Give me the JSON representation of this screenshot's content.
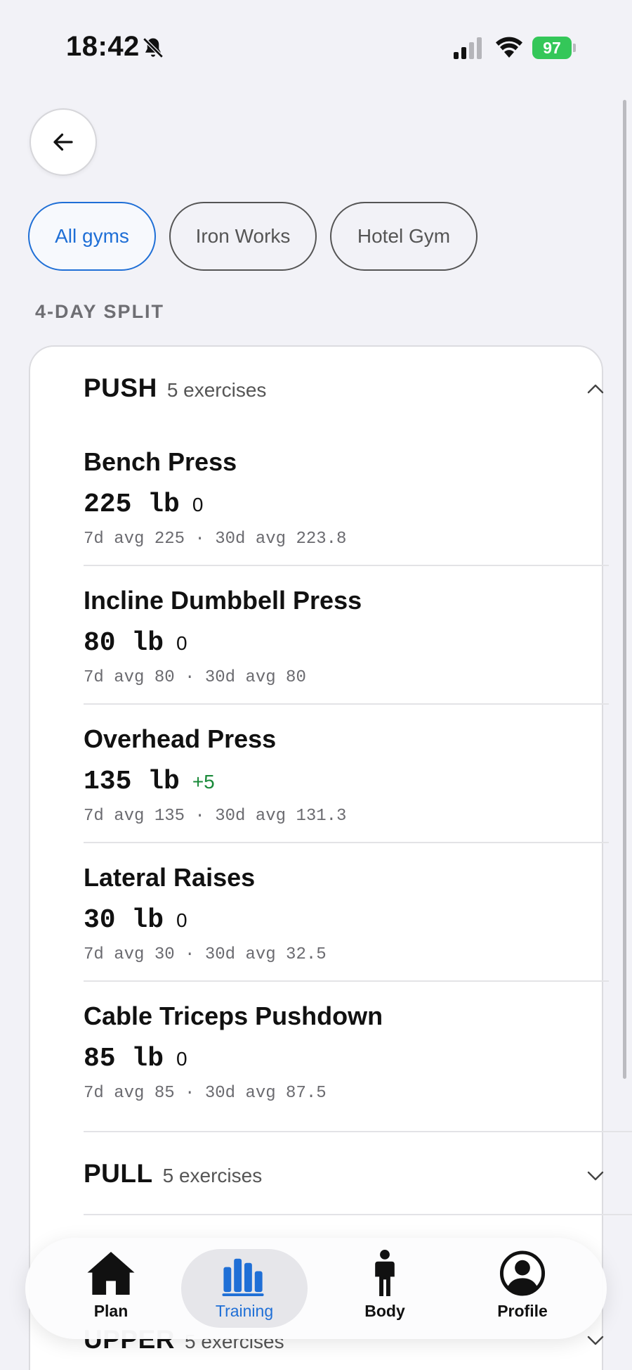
{
  "status_bar": {
    "time": "18:42",
    "battery": "97"
  },
  "filters": {
    "chips": [
      {
        "label": "All gyms",
        "active": true
      },
      {
        "label": "Iron Works",
        "active": false
      },
      {
        "label": "Hotel Gym",
        "active": false
      }
    ]
  },
  "section_label": "4-DAY SPLIT",
  "groups": {
    "push": {
      "name": "PUSH",
      "count": "5 exercises",
      "expanded": true,
      "exercises": [
        {
          "name": "Bench Press",
          "weight": "225 lb",
          "delta": "0",
          "avgs": "7d avg 225 · 30d avg 223.8"
        },
        {
          "name": "Incline Dumbbell Press",
          "weight": "80 lb",
          "delta": "0",
          "avgs": "7d avg 80 · 30d avg 80"
        },
        {
          "name": "Overhead Press",
          "weight": "135 lb",
          "delta": "+5",
          "avgs": "7d avg 135 · 30d avg 131.3"
        },
        {
          "name": "Lateral Raises",
          "weight": "30 lb",
          "delta": "0",
          "avgs": "7d avg 30 · 30d avg 32.5"
        },
        {
          "name": "Cable Triceps Pushdown",
          "weight": "85 lb",
          "delta": "0",
          "avgs": "7d avg 85 · 30d avg 87.5"
        }
      ]
    },
    "pull": {
      "name": "PULL",
      "count": "5 exercises",
      "expanded": false
    },
    "upper": {
      "name": "UPPER",
      "count": "5 exercises",
      "expanded": false
    }
  },
  "tab_bar": {
    "tabs": [
      {
        "label": "Plan",
        "icon": "home-icon",
        "active": false
      },
      {
        "label": "Training",
        "icon": "bar-chart-icon",
        "active": true
      },
      {
        "label": "Body",
        "icon": "person-icon",
        "active": false
      },
      {
        "label": "Profile",
        "icon": "profile-icon",
        "active": false
      }
    ]
  },
  "colors": {
    "accent": "#1f6fd6",
    "positive": "#1a8a3a",
    "battery": "#34c759"
  }
}
